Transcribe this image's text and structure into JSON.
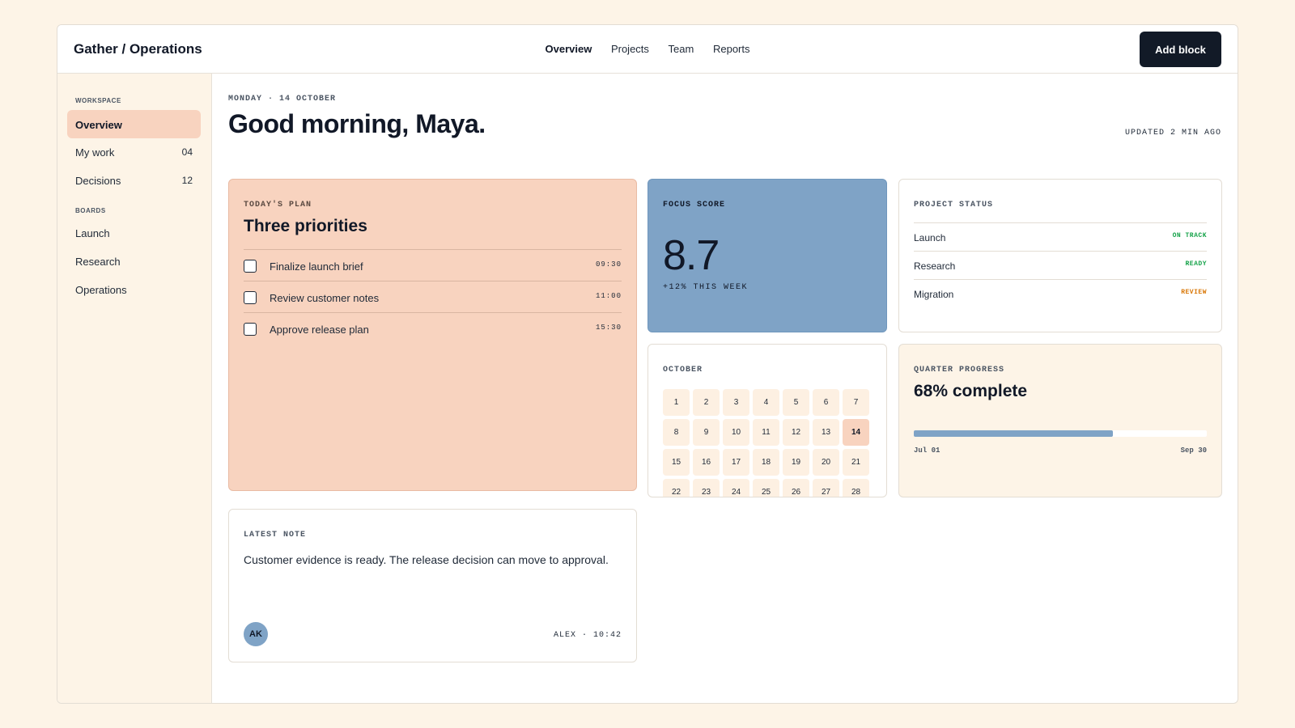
{
  "app": {
    "brand": "Gather / Operations"
  },
  "nav": {
    "items": [
      {
        "label": "Overview",
        "active": true
      },
      {
        "label": "Projects",
        "active": false
      },
      {
        "label": "Team",
        "active": false
      },
      {
        "label": "Reports",
        "active": false
      }
    ],
    "add_button": "Add block"
  },
  "sidebar": {
    "workspace_heading": "WORKSPACE",
    "workspace_items": [
      {
        "label": "Overview",
        "count": "",
        "active": true
      },
      {
        "label": "My work",
        "count": "04",
        "active": false
      },
      {
        "label": "Decisions",
        "count": "12",
        "active": false
      }
    ],
    "boards_heading": "BOARDS",
    "board_items": [
      {
        "label": "Launch"
      },
      {
        "label": "Research"
      },
      {
        "label": "Operations"
      }
    ]
  },
  "header": {
    "date_line": "MONDAY · 14 OCTOBER",
    "greeting": "Good morning, Maya.",
    "updated": "UPDATED 2 MIN AGO"
  },
  "plan": {
    "label": "TODAY'S PLAN",
    "title": "Three priorities",
    "tasks": [
      {
        "name": "Finalize launch brief",
        "time": "09:30",
        "checked": false
      },
      {
        "name": "Review customer notes",
        "time": "11:00",
        "checked": false
      },
      {
        "name": "Approve release plan",
        "time": "15:30",
        "checked": false
      }
    ]
  },
  "focus": {
    "label": "FOCUS SCORE",
    "score": "8.7",
    "change": "+12% THIS WEEK"
  },
  "project_status": {
    "label": "PROJECT STATUS",
    "rows": [
      {
        "name": "Launch",
        "status": "ON TRACK",
        "color": "#16a34a"
      },
      {
        "name": "Research",
        "status": "READY",
        "color": "#16a34a"
      },
      {
        "name": "Migration",
        "status": "REVIEW",
        "color": "#d97706"
      }
    ]
  },
  "calendar": {
    "label": "OCTOBER",
    "days": [
      "1",
      "2",
      "3",
      "4",
      "5",
      "6",
      "7",
      "8",
      "9",
      "10",
      "11",
      "12",
      "13",
      "14",
      "15",
      "16",
      "17",
      "18",
      "19",
      "20",
      "21",
      "22",
      "23",
      "24",
      "25",
      "26",
      "27",
      "28"
    ],
    "today": "14"
  },
  "quarter": {
    "label": "QUARTER PROGRESS",
    "title": "68% complete",
    "progress": 0.68,
    "start": "Jul 01",
    "end": "Sep 30"
  },
  "note": {
    "label": "LATEST NOTE",
    "text": "Customer evidence is ready. The release decision can move to approval.",
    "avatar": "AK",
    "meta": "ALEX · 10:42"
  },
  "colors": {
    "background": "#fdf4e7",
    "accent_peach": "#f8d3bf",
    "accent_blue": "#7fa3c6",
    "button_dark": "#121a27"
  }
}
